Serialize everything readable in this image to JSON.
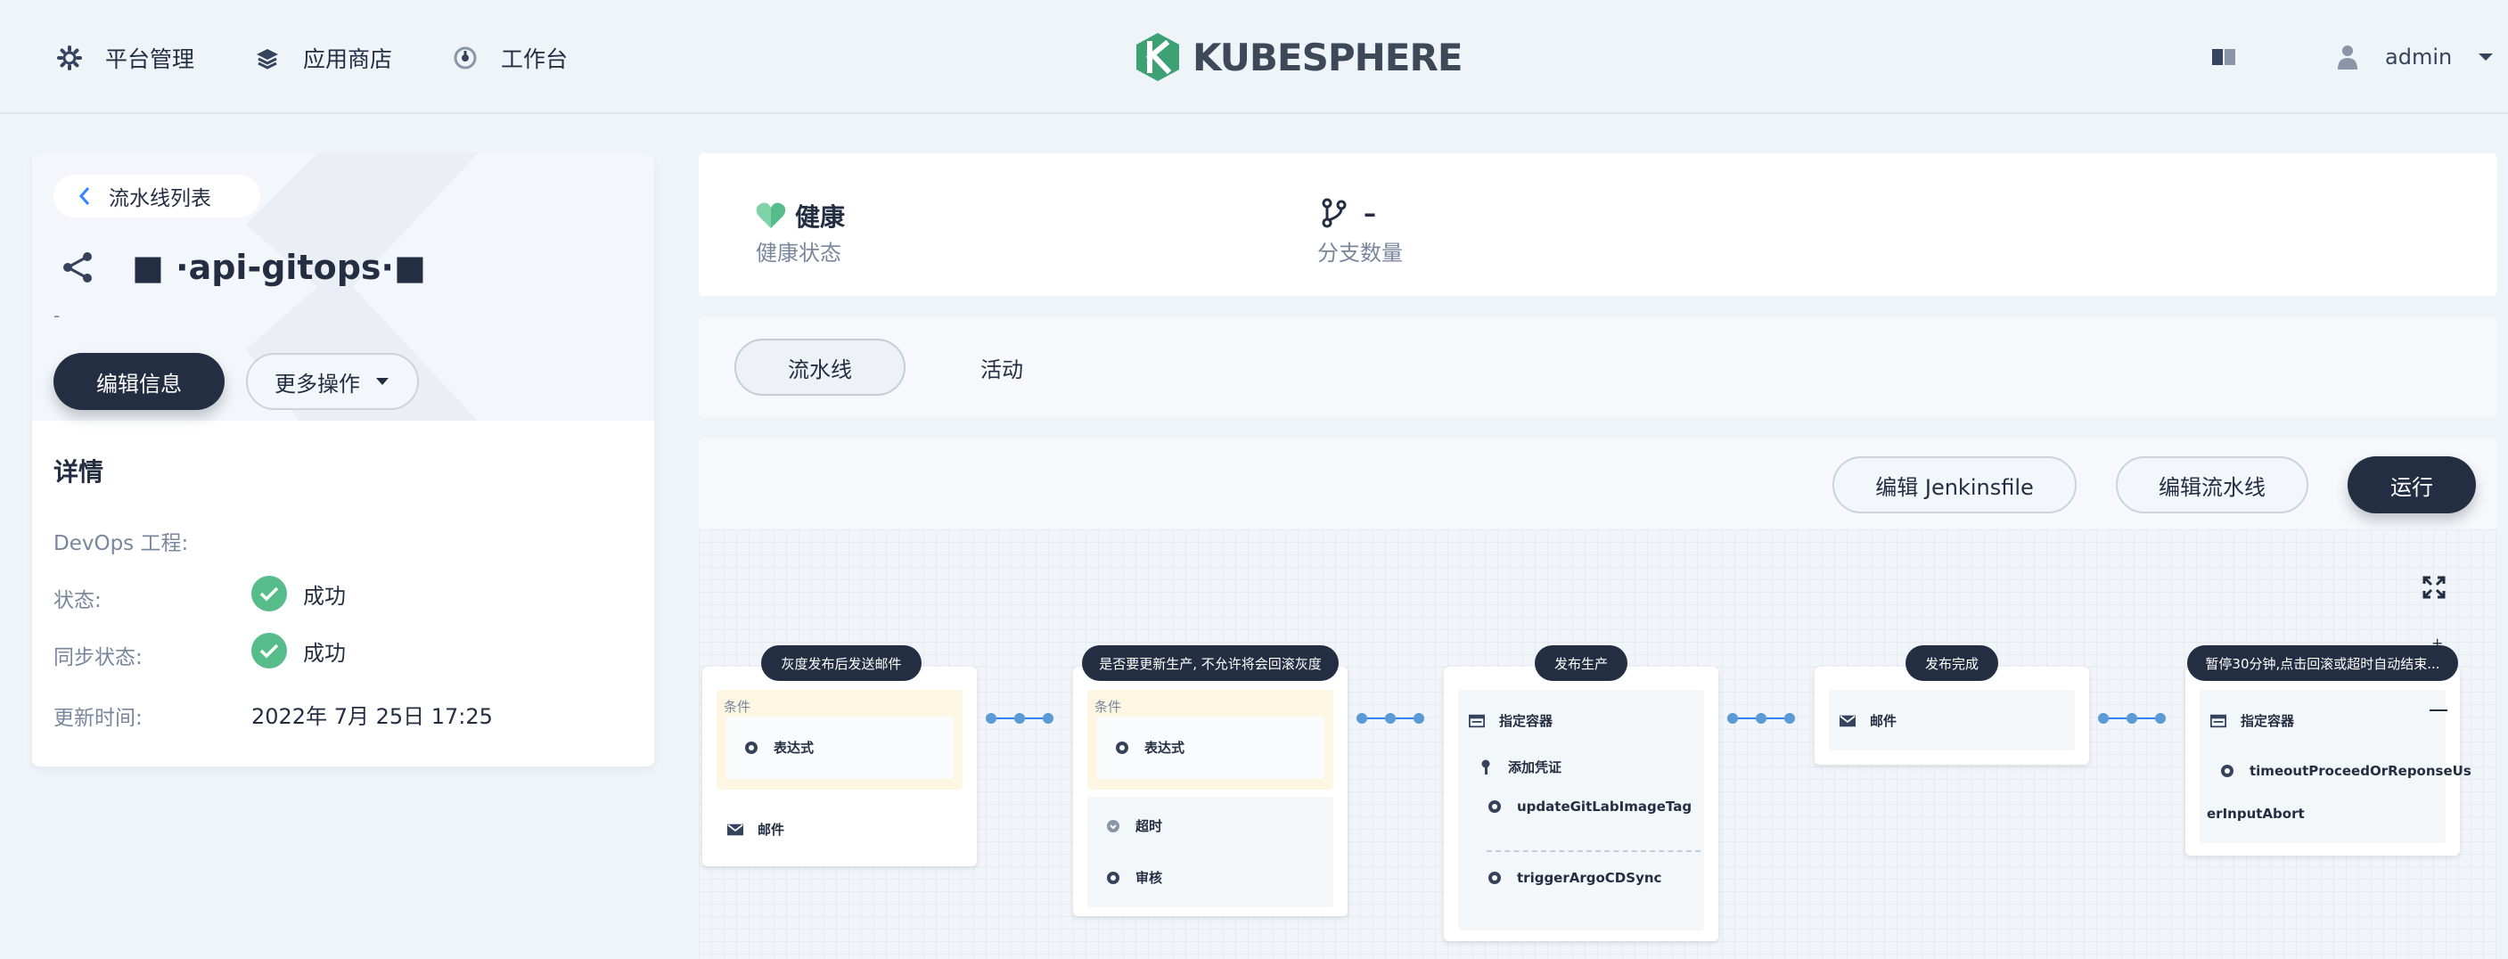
{
  "nav": {
    "platform": "平台管理",
    "appstore": "应用商店",
    "workbench": "工作台",
    "logo": "KUBESPHERE",
    "user": "admin"
  },
  "left": {
    "back_label": "流水线列表",
    "title": "■ ·api-gitops·■",
    "desc": "-",
    "edit_btn": "编辑信息",
    "more_btn": "更多操作",
    "details_title": "详情",
    "details": [
      {
        "label": "DevOps 工程:",
        "value": ""
      },
      {
        "label": "状态:",
        "value": "成功"
      },
      {
        "label": "同步状态:",
        "value": "成功"
      },
      {
        "label": "更新时间:",
        "value": "2022年 7月 25日 17:25"
      }
    ]
  },
  "health": {
    "value": "健康",
    "label": "健康状态",
    "branch_value": "–",
    "branch_label": "分支数量"
  },
  "tabs": {
    "pipeline": "流水线",
    "activity": "活动"
  },
  "toolbar": {
    "edit_jenkinsfile": "编辑 Jenkinsfile",
    "edit_pipeline": "编辑流水线",
    "run": "运行"
  },
  "stages": [
    {
      "title": "灰度发布后发送邮件",
      "cond_label": "条件",
      "cond_step": "表达式",
      "steps": [
        "邮件"
      ]
    },
    {
      "title": "是否要更新生产, 不允许将会回滚灰度",
      "cond_label": "条件",
      "cond_step": "表达式",
      "steps": [
        "超时",
        "审核"
      ]
    },
    {
      "title": "发布生产",
      "group": "指定容器",
      "steps": [
        "添加凭证",
        "updateGitLabImageTag",
        "triggerArgoCDSync"
      ]
    },
    {
      "title": "发布完成",
      "steps": [
        "邮件"
      ]
    },
    {
      "title": "暂停30分钟,点击回滚或超时自动结束...",
      "group": "指定容器",
      "steps": [
        "timeoutProceedOrReponseUs",
        "erInputAbort"
      ]
    }
  ],
  "colors": {
    "dark": "#242e42",
    "success": "#55bc8a",
    "health": "#55bc8a",
    "connector": "#5b9bd5"
  }
}
